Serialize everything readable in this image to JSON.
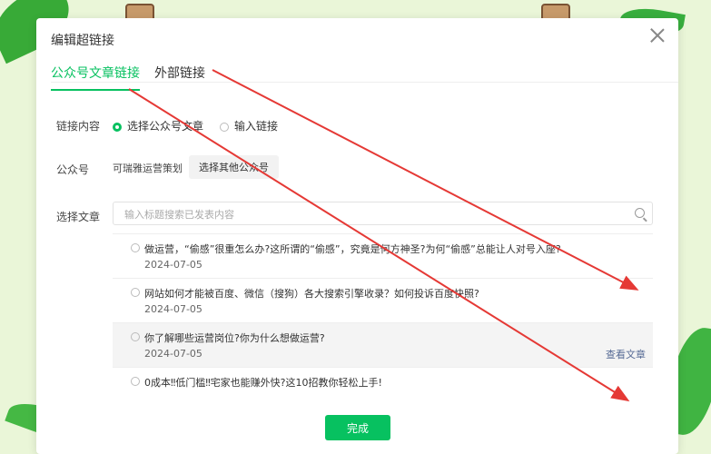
{
  "dialog": {
    "title": "编辑超链接",
    "tabs": [
      {
        "label": "公众号文章链接",
        "active": true
      },
      {
        "label": "外部链接",
        "active": false
      }
    ],
    "link_content": {
      "label": "链接内容",
      "options": [
        {
          "label": "选择公众号文章",
          "selected": true
        },
        {
          "label": "输入链接",
          "selected": false
        }
      ]
    },
    "account": {
      "label": "公众号",
      "name": "可瑞雅运营策划",
      "other_button": "选择其他公众号"
    },
    "article": {
      "label": "选择文章",
      "search_placeholder": "输入标题搜索已发表内容",
      "items": [
        {
          "title": "做运营，“偷感”很重怎么办?这所谓的“偷感”，究竟是何方神圣?为何“偷感”总能让人对号入座?",
          "date": "2024-07-05"
        },
        {
          "title": "网站如何才能被百度、微信（搜狗）各大搜索引擎收录？如何投诉百度快照?",
          "date": "2024-07-05"
        },
        {
          "title": "你了解哪些运营岗位?你为什么想做运营?",
          "date": "2024-07-05",
          "view_label": "查看文章"
        },
        {
          "title": "0成本‼低门槛‼宅家也能赚外快?这10招教你轻松上手!",
          "date": ""
        }
      ]
    },
    "done_button": "完成"
  },
  "colors": {
    "accent": "#07c160",
    "link": "#576b95",
    "annotation": "#e53935",
    "background": "#eaf6d8"
  }
}
